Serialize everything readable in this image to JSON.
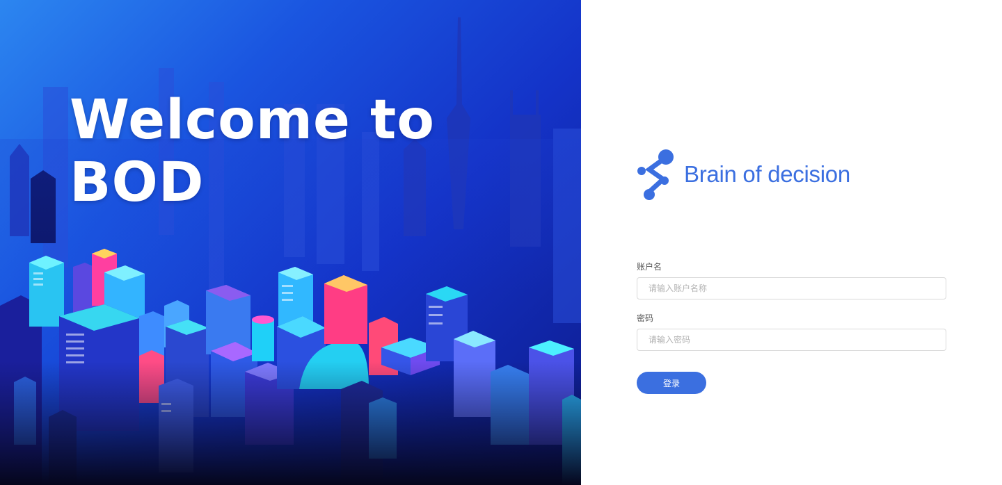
{
  "hero": {
    "title_line1": "Welcome to",
    "title_line2": "BOD"
  },
  "brand": {
    "logo_icon": "molecule-s-icon",
    "name": "Brain of decision",
    "color": "#3b6fe0"
  },
  "form": {
    "username": {
      "label": "账户名",
      "placeholder": "请输入账户名称",
      "value": ""
    },
    "password": {
      "label": "密码",
      "placeholder": "请输入密码",
      "value": ""
    },
    "submit_label": "登录"
  }
}
